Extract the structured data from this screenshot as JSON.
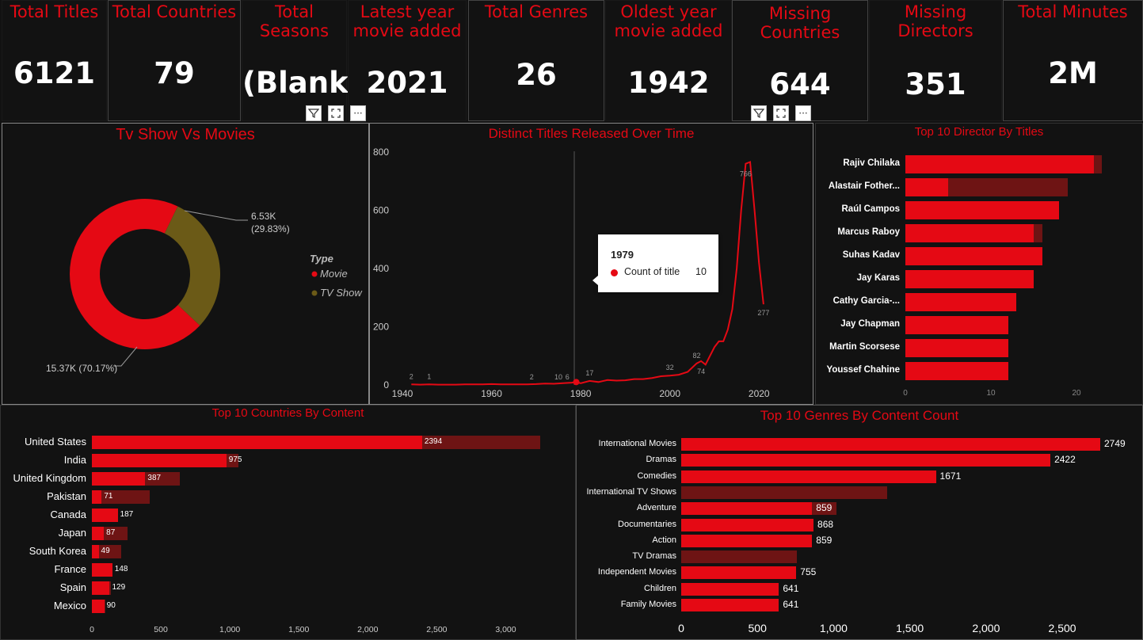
{
  "kpis": [
    {
      "title": "Total Titles",
      "value": "6121"
    },
    {
      "title": "Total Countries",
      "value": "79"
    },
    {
      "title": "Total Seasons",
      "value": "(Blank)"
    },
    {
      "title": "Latest year movie added",
      "value": "2021"
    },
    {
      "title": "Total Genres",
      "value": "26"
    },
    {
      "title": "Oldest year movie added",
      "value": "1942"
    },
    {
      "title": "Missing Countries",
      "value": "644"
    },
    {
      "title": "Missing Directors",
      "value": "351"
    },
    {
      "title": "Total Minutes",
      "value": "2M"
    }
  ],
  "header_icons": {
    "filter": "filter-icon",
    "focus": "focus-mode-icon",
    "more": "more-options-icon"
  },
  "donut": {
    "title": "Tv Show Vs Movies",
    "legend_title": "Type",
    "slices": [
      {
        "name": "Movie",
        "value": 15370,
        "percent": 70.17,
        "label": "15.37K (70.17%)",
        "color": "#e50914"
      },
      {
        "name": "TV Show",
        "value": 6530,
        "percent": 29.83,
        "label_line1": "6.53K",
        "label_line2": "(29.83%)",
        "color": "#6b5a17"
      }
    ]
  },
  "line": {
    "title": "Distinct Titles Released Over Time",
    "y_ticks": [
      "800",
      "600",
      "400",
      "200",
      "0"
    ],
    "x_ticks": [
      "1940",
      "1960",
      "1980",
      "2000",
      "2020"
    ],
    "tooltip": {
      "year": "1979",
      "label": "Count of title",
      "value": "10"
    }
  },
  "directors": {
    "title": "Top 10 Director By Titles",
    "x_ticks": [
      "0",
      "10",
      "20"
    ]
  },
  "countries": {
    "title": "Top 10 Countries By Content",
    "x_ticks": [
      "0",
      "500",
      "1,000",
      "1,500",
      "2,000",
      "2,500",
      "3,000"
    ]
  },
  "genres": {
    "title": "Top 10 Genres By Content Count",
    "x_ticks": [
      "0",
      "500",
      "1,000",
      "1,500",
      "2,000",
      "2,500"
    ]
  },
  "colors": {
    "accent": "#e50914",
    "dark_bar": "#6e1414",
    "tv_show": "#6b5a17",
    "background": "#121212"
  },
  "chart_data": [
    {
      "type": "pie",
      "title": "Tv Show Vs Movies",
      "categories": [
        "Movie",
        "TV Show"
      ],
      "values": [
        15370,
        6530
      ],
      "percents": [
        70.17,
        29.83
      ]
    },
    {
      "type": "line",
      "title": "Distinct Titles Released Over Time",
      "x": [
        1942,
        1944,
        1946,
        1948,
        1950,
        1952,
        1954,
        1956,
        1958,
        1960,
        1962,
        1964,
        1966,
        1968,
        1970,
        1972,
        1974,
        1976,
        1978,
        1979,
        1980,
        1982,
        1984,
        1986,
        1988,
        1990,
        1992,
        1994,
        1996,
        1998,
        2000,
        2002,
        2004,
        2006,
        2007,
        2008,
        2009,
        2010,
        2011,
        2012,
        2013,
        2014,
        2015,
        2016,
        2017,
        2018,
        2019,
        2020,
        2021
      ],
      "y": [
        2,
        1,
        2,
        1,
        1,
        1,
        2,
        2,
        2,
        3,
        2,
        2,
        2,
        2,
        3,
        5,
        4,
        6,
        8,
        10,
        6,
        14,
        10,
        17,
        15,
        16,
        20,
        20,
        24,
        30,
        32,
        35,
        45,
        74,
        82,
        70,
        100,
        130,
        150,
        150,
        190,
        260,
        400,
        600,
        760,
        766,
        600,
        420,
        277
      ],
      "point_labels": [
        {
          "x": 1942,
          "label": "2"
        },
        {
          "x": 1946,
          "label": "1"
        },
        {
          "x": 1969,
          "label": "2"
        },
        {
          "x": 1975,
          "label": "10"
        },
        {
          "x": 1977,
          "label": "6"
        },
        {
          "x": 1982,
          "label": "17"
        },
        {
          "x": 2000,
          "label": "32"
        },
        {
          "x": 2007,
          "label": "74"
        },
        {
          "x": 2006,
          "label": "82"
        },
        {
          "x": 2017,
          "label": "766"
        },
        {
          "x": 2021,
          "label": "277"
        }
      ],
      "xlim": [
        1940,
        2022
      ],
      "ylim": [
        0,
        800
      ]
    },
    {
      "type": "bar",
      "title": "Top 10 Director By Titles",
      "categories": [
        "Rajiv Chilaka",
        "Alastair Fother...",
        "Raúl Campos",
        "Marcus Raboy",
        "Suhas Kadav",
        "Jay Karas",
        "Cathy Garcia-...",
        "Jay Chapman",
        "Martin Scorsese",
        "Youssef Chahine"
      ],
      "series": [
        {
          "values": [
            22,
            5,
            18,
            15,
            16,
            15,
            13,
            12,
            12,
            12
          ]
        },
        {
          "values": [
            23,
            19,
            18,
            16,
            16,
            15,
            13,
            12,
            12,
            12
          ]
        }
      ],
      "xlim": [
        0,
        25
      ]
    },
    {
      "type": "bar",
      "title": "Top 10 Countries By Content",
      "categories": [
        "United States",
        "India",
        "United Kingdom",
        "Pakistan",
        "Canada",
        "Japan",
        "South Korea",
        "France",
        "Spain",
        "Mexico"
      ],
      "series": [
        {
          "values": [
            2394,
            975,
            387,
            71,
            187,
            87,
            49,
            148,
            129,
            90
          ]
        },
        {
          "values": [
            3250,
            1060,
            640,
            420,
            190,
            260,
            215,
            150,
            140,
            100
          ]
        }
      ],
      "data_labels": [
        "2394",
        "975",
        "387",
        "71",
        "187",
        "87",
        "49",
        "148",
        "129",
        "90"
      ],
      "xlim": [
        0,
        3300
      ]
    },
    {
      "type": "bar",
      "title": "Top 10 Genres By Content Count",
      "categories": [
        "International Movies",
        "Dramas",
        "Comedies",
        "International TV Shows",
        "Adventure",
        "Documentaries",
        "Action",
        "TV Dramas",
        "Independent Movies",
        "Children",
        "Family Movies"
      ],
      "series": [
        {
          "values": [
            2749,
            2422,
            1671,
            0,
            859,
            868,
            859,
            0,
            755,
            641,
            641
          ]
        },
        {
          "values": [
            2749,
            2422,
            1671,
            1350,
            1020,
            868,
            859,
            760,
            755,
            641,
            641
          ]
        }
      ],
      "data_labels": [
        "2749",
        "2422",
        "1671",
        "",
        "859",
        "868",
        "859",
        "",
        "755",
        "641",
        "641"
      ],
      "xlim": [
        0,
        2900
      ]
    }
  ]
}
